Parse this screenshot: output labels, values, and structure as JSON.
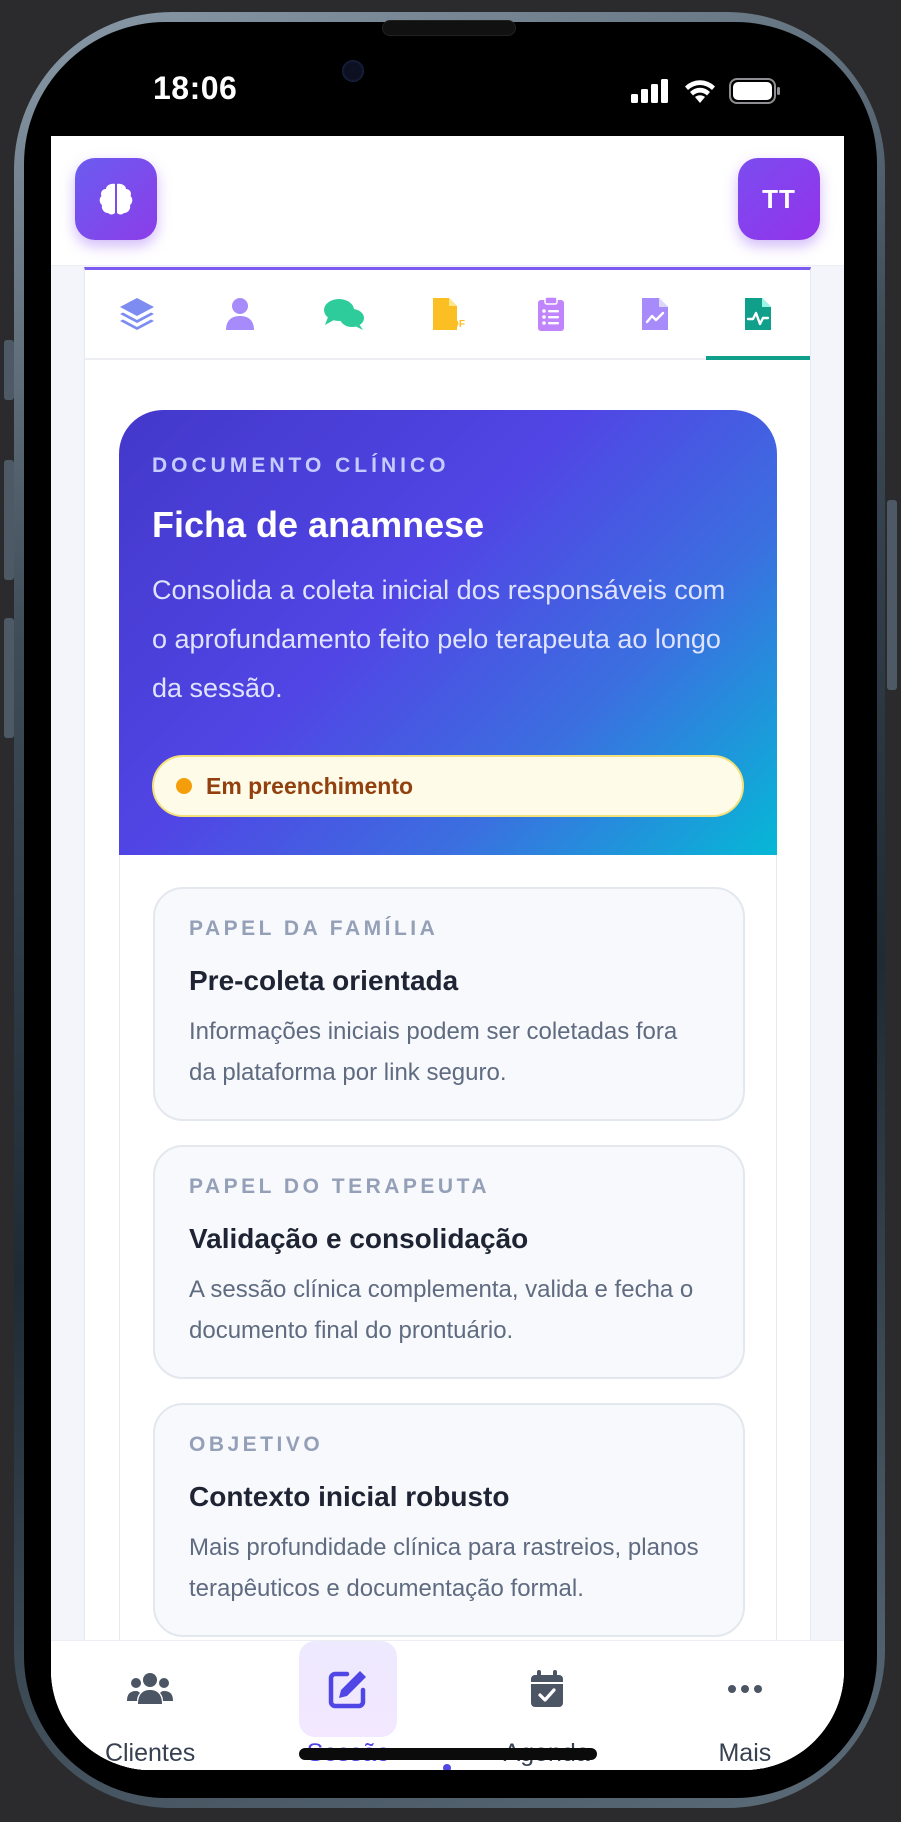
{
  "status_bar": {
    "time": "18:06"
  },
  "header": {
    "avatar_initials": "TT",
    "logo_icon": "brain-icon"
  },
  "tabs": [
    {
      "icon": "layers-icon",
      "color": "#7c8cf0"
    },
    {
      "icon": "user-icon",
      "color": "#a78bfa"
    },
    {
      "icon": "chat-icon",
      "color": "#2ecc9a"
    },
    {
      "icon": "pdf-file-icon",
      "color": "#fbbf24"
    },
    {
      "icon": "clipboard-list-icon",
      "color": "#c084fc"
    },
    {
      "icon": "file-chart-icon",
      "color": "#a78bfa"
    },
    {
      "icon": "file-medical-icon",
      "color": "#0f9f8a",
      "active": true
    }
  ],
  "hero": {
    "eyebrow": "DOCUMENTO CLÍNICO",
    "title": "Ficha de anamnese",
    "description": "Consolida a coleta inicial dos responsáveis com o aprofundamento feito pelo terapeuta ao longo da sessão.",
    "badge": "Em preenchimento",
    "badge_color": "#f59e0b"
  },
  "cards": [
    {
      "eyebrow": "PAPEL DA FAMÍLIA",
      "title": "Pre-coleta orientada",
      "description": "Informações iniciais podem ser coletadas fora da plataforma por link seguro."
    },
    {
      "eyebrow": "PAPEL DO TERAPEUTA",
      "title": "Validação e consolidação",
      "description": "A sessão clínica complementa, valida e fecha o documento final do prontuário."
    },
    {
      "eyebrow": "OBJETIVO",
      "title": "Contexto inicial robusto",
      "description": "Mais profundidade clínica para rastreios, planos terapêuticos e documentação formal."
    }
  ],
  "bottom_nav": [
    {
      "label": "Clientes",
      "icon": "users-icon"
    },
    {
      "label": "Sessão",
      "icon": "edit-icon",
      "active": true
    },
    {
      "label": "Agenda",
      "icon": "calendar-check-icon"
    },
    {
      "label": "Mais",
      "icon": "more-dots-icon"
    }
  ],
  "colors": {
    "accent": "#4f46e5",
    "brand_purple": "#7c3aed",
    "active_tab": "#0f9f8a"
  }
}
